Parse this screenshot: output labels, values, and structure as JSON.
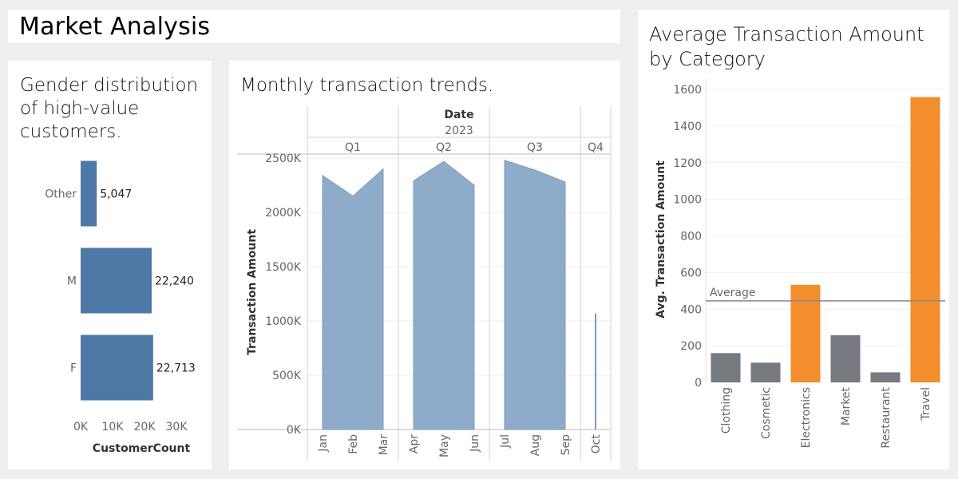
{
  "page_title": "Market Analysis",
  "colors": {
    "bar_blue": "#4e79a7",
    "area_blue": "#8fabca",
    "gray_bar": "#76797f",
    "orange_bar": "#f28e2b",
    "axis_text": "#666666",
    "grid": "#ececec"
  },
  "chart_data": [
    {
      "type": "bar",
      "orientation": "horizontal",
      "title": "Gender distribution of high-value customers.",
      "title_lines": [
        "Gender distribution",
        "of high-value",
        "customers."
      ],
      "categories": [
        "Other",
        "M",
        "F"
      ],
      "values": [
        5047,
        22240,
        22713
      ],
      "value_labels": [
        "5,047",
        "22,240",
        "22,713"
      ],
      "xlabel": "CustomerCount",
      "ylabel": "",
      "xlim": [
        0,
        38000
      ],
      "x_ticks": [
        0,
        10000,
        20000,
        30000
      ],
      "x_tick_labels": [
        "0K",
        "10K",
        "20K",
        "30K"
      ]
    },
    {
      "type": "area",
      "title": "Monthly transaction trends.",
      "header_label": "Date",
      "year": "2023",
      "quarters": [
        {
          "label": "Q1",
          "months": [
            "Jan",
            "Feb",
            "Mar"
          ],
          "values": [
            2340000,
            2150000,
            2400000
          ]
        },
        {
          "label": "Q2",
          "months": [
            "Apr",
            "May",
            "Jun"
          ],
          "values": [
            2290000,
            2470000,
            2250000
          ]
        },
        {
          "label": "Q3",
          "months": [
            "Jul",
            "Aug",
            "Sep"
          ],
          "values": [
            2480000,
            2390000,
            2280000
          ]
        },
        {
          "label": "Q4",
          "months": [
            "Oct"
          ],
          "values": [
            1070000
          ]
        }
      ],
      "ylabel": "Transaction Amount",
      "xlabel": "",
      "ylim": [
        0,
        2500000
      ],
      "y_ticks": [
        0,
        500000,
        1000000,
        1500000,
        2000000,
        2500000
      ],
      "y_tick_labels": [
        "0K",
        "500K",
        "1000K",
        "1500K",
        "2000K",
        "2500K"
      ]
    },
    {
      "type": "bar",
      "title": "Average Transaction Amount by Category",
      "title_lines": [
        "Average Transaction Amount",
        "by Category"
      ],
      "categories": [
        "Clothing",
        "Cosmetic",
        "Electronics",
        "Market",
        "Restaurant",
        "Travel"
      ],
      "values": [
        160,
        108,
        533,
        258,
        55,
        1558
      ],
      "highlight": [
        false,
        false,
        true,
        false,
        false,
        true
      ],
      "ylabel": "Avg. Transaction Amount",
      "xlabel": "",
      "ylim": [
        0,
        1650
      ],
      "y_ticks": [
        0,
        200,
        400,
        600,
        800,
        1000,
        1200,
        1400,
        1600
      ],
      "y_tick_labels": [
        "0",
        "200",
        "400",
        "600",
        "800",
        "1000",
        "1200",
        "1400",
        "1600"
      ],
      "reference_line": {
        "label": "Average",
        "value": 445
      }
    }
  ]
}
